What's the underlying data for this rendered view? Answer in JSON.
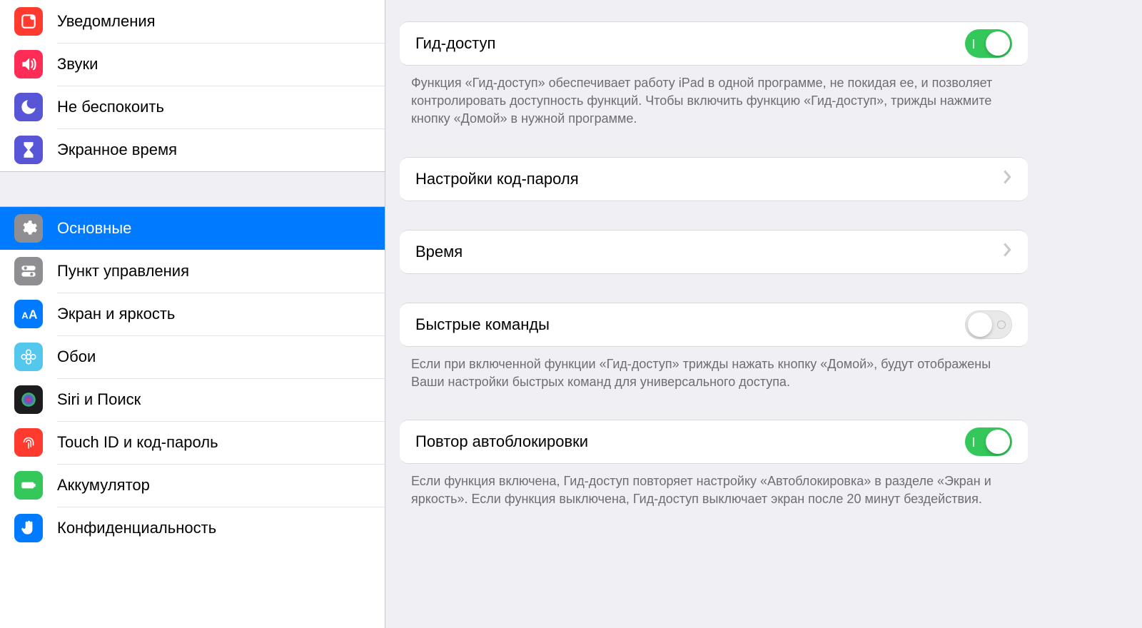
{
  "sidebar": {
    "group1": [
      {
        "key": "notifications",
        "label": "Уведомления"
      },
      {
        "key": "sounds",
        "label": "Звуки"
      },
      {
        "key": "dnd",
        "label": "Не беспокоить"
      },
      {
        "key": "screentime",
        "label": "Экранное время"
      }
    ],
    "group2": [
      {
        "key": "general",
        "label": "Основные",
        "selected": true
      },
      {
        "key": "control",
        "label": "Пункт управления"
      },
      {
        "key": "display",
        "label": "Экран и яркость"
      },
      {
        "key": "wallpaper",
        "label": "Обои"
      },
      {
        "key": "siri",
        "label": "Siri и Поиск"
      },
      {
        "key": "touchid",
        "label": "Touch ID и код-пароль"
      },
      {
        "key": "battery",
        "label": "Аккумулятор"
      },
      {
        "key": "privacy",
        "label": "Конфиденциальность"
      }
    ]
  },
  "detail": {
    "guided_access": {
      "label": "Гид-доступ",
      "on": true,
      "footer": "Функция «Гид-доступ» обеспечивает работу iPad в одной программе, не покидая ее, и позволяет контролировать доступность функций. Чтобы включить функцию «Гид-доступ», трижды нажмите кнопку «Домой» в нужной программе."
    },
    "passcode": {
      "label": "Настройки код-пароля"
    },
    "time": {
      "label": "Время"
    },
    "shortcut": {
      "label": "Быстрые команды",
      "on": false,
      "footer": "Если при включенной функции «Гид-доступ» трижды нажать кнопку «Домой», будут отображены Ваши настройки быстрых команд для универсального доступа."
    },
    "autolock": {
      "label": "Повтор автоблокировки",
      "on": true,
      "footer": "Если функция включена, Гид-доступ повторяет настройку «Автоблокировка» в разделе «Экран и яркость». Если функция выключена, Гид-доступ выключает экран после 20 минут бездействия."
    }
  }
}
